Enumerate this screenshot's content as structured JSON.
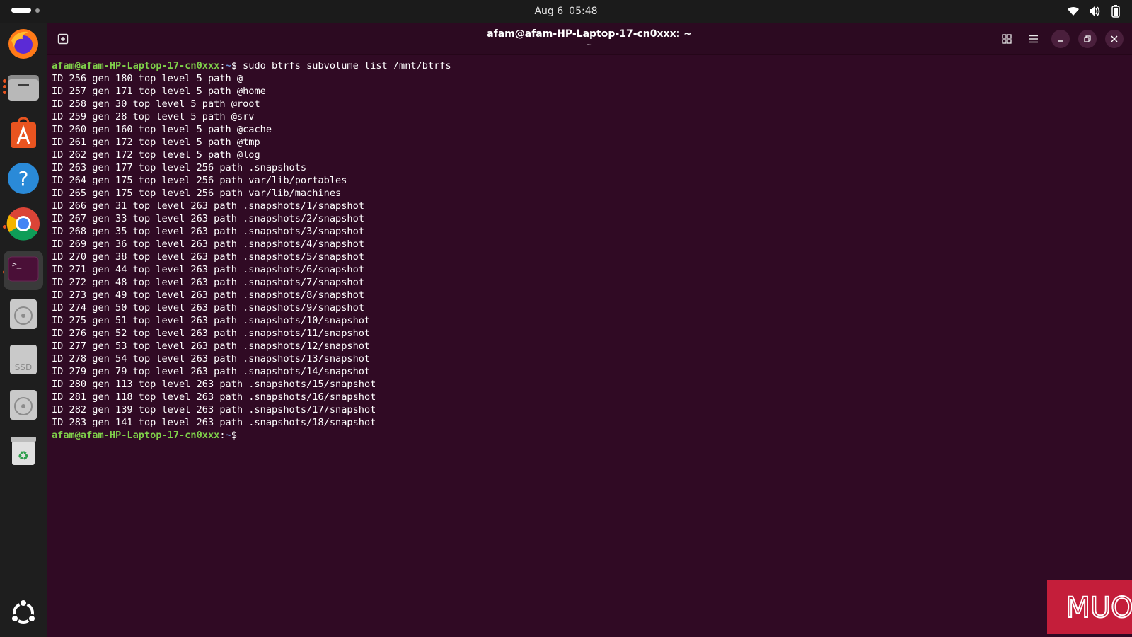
{
  "topbar": {
    "date": "Aug 6",
    "time": "05:48"
  },
  "window": {
    "title": "afam@afam-HP-Laptop-17-cn0xxx: ~",
    "subtitle": "~"
  },
  "terminal": {
    "prompt_user": "afam@afam-HP-Laptop-17-cn0xxx",
    "prompt_sep": ":",
    "prompt_path": "~",
    "prompt_symbol": "$",
    "command": " sudo btrfs subvolume list /mnt/btrfs",
    "output": [
      "ID 256 gen 180 top level 5 path @",
      "ID 257 gen 171 top level 5 path @home",
      "ID 258 gen 30 top level 5 path @root",
      "ID 259 gen 28 top level 5 path @srv",
      "ID 260 gen 160 top level 5 path @cache",
      "ID 261 gen 172 top level 5 path @tmp",
      "ID 262 gen 172 top level 5 path @log",
      "ID 263 gen 177 top level 256 path .snapshots",
      "ID 264 gen 175 top level 256 path var/lib/portables",
      "ID 265 gen 175 top level 256 path var/lib/machines",
      "ID 266 gen 31 top level 263 path .snapshots/1/snapshot",
      "ID 267 gen 33 top level 263 path .snapshots/2/snapshot",
      "ID 268 gen 35 top level 263 path .snapshots/3/snapshot",
      "ID 269 gen 36 top level 263 path .snapshots/4/snapshot",
      "ID 270 gen 38 top level 263 path .snapshots/5/snapshot",
      "ID 271 gen 44 top level 263 path .snapshots/6/snapshot",
      "ID 272 gen 48 top level 263 path .snapshots/7/snapshot",
      "ID 273 gen 49 top level 263 path .snapshots/8/snapshot",
      "ID 274 gen 50 top level 263 path .snapshots/9/snapshot",
      "ID 275 gen 51 top level 263 path .snapshots/10/snapshot",
      "ID 276 gen 52 top level 263 path .snapshots/11/snapshot",
      "ID 277 gen 53 top level 263 path .snapshots/12/snapshot",
      "ID 278 gen 54 top level 263 path .snapshots/13/snapshot",
      "ID 279 gen 79 top level 263 path .snapshots/14/snapshot",
      "ID 280 gen 113 top level 263 path .snapshots/15/snapshot",
      "ID 281 gen 118 top level 263 path .snapshots/16/snapshot",
      "ID 282 gen 139 top level 263 path .snapshots/17/snapshot",
      "ID 283 gen 141 top level 263 path .snapshots/18/snapshot"
    ]
  },
  "dock": {
    "items": [
      {
        "icon": "firefox-icon"
      },
      {
        "icon": "files-icon"
      },
      {
        "icon": "app-center-icon"
      },
      {
        "icon": "help-icon"
      },
      {
        "icon": "chrome-icon"
      },
      {
        "icon": "terminal-icon"
      },
      {
        "icon": "disc-drive-icon"
      },
      {
        "icon": "ssd-drive-icon",
        "label": "SSD"
      },
      {
        "icon": "disc-drive-icon"
      },
      {
        "icon": "trash-icon"
      },
      {
        "icon": "show-apps-icon"
      }
    ]
  },
  "watermark": {
    "text": "MUO"
  },
  "colors": {
    "terminal_bg": "#300a24",
    "prompt_user": "#7fd04a",
    "prompt_path": "#6b8fd4",
    "accent": "#e95420"
  }
}
